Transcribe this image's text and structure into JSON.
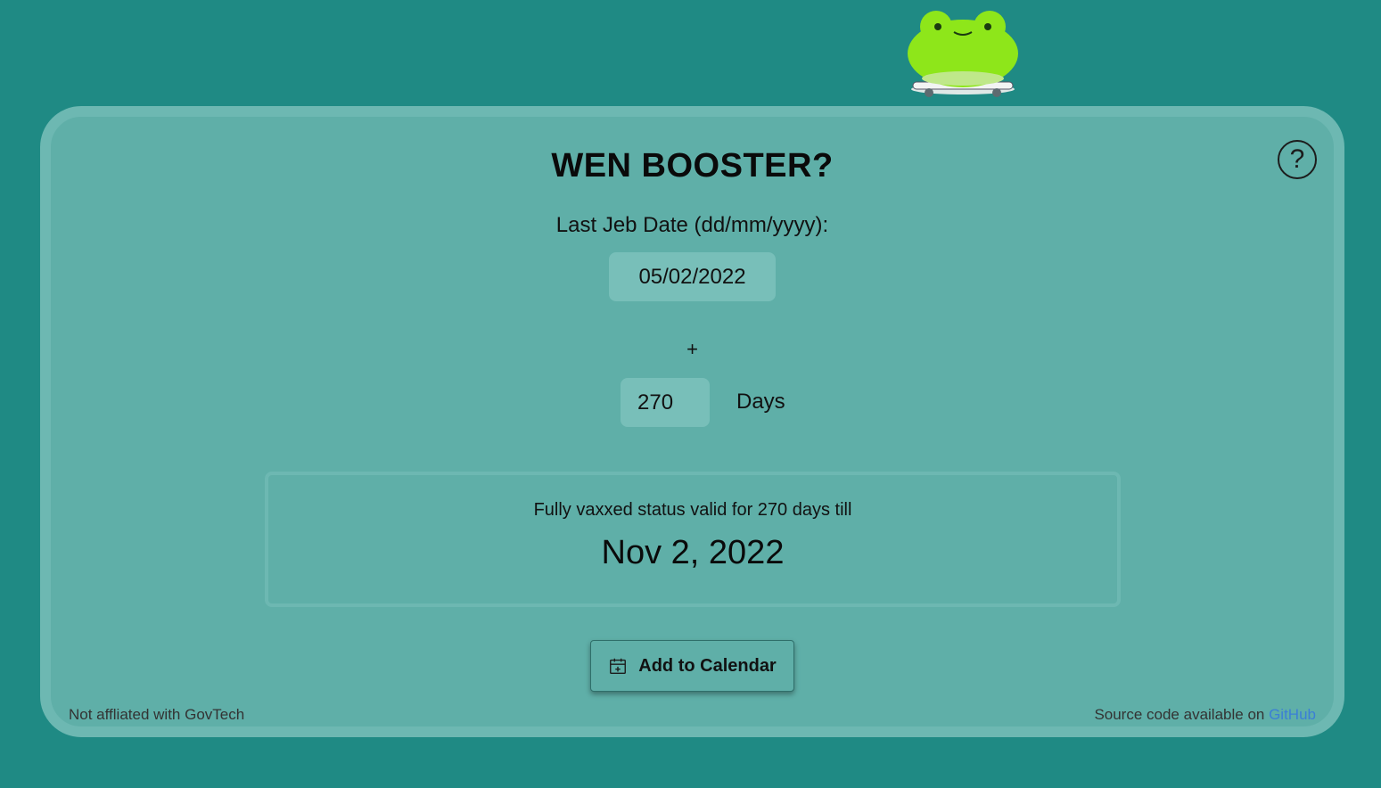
{
  "app": {
    "title": "WEN BOOSTER?",
    "help_label": "?"
  },
  "form": {
    "date_label": "Last Jeb Date (dd/mm/yyyy):",
    "date_value": "05/02/2022",
    "plus_sign": "+",
    "days_value": "270",
    "days_label": "Days"
  },
  "result": {
    "text": "Fully vaxxed status valid for 270 days till",
    "date": "Nov 2, 2022"
  },
  "actions": {
    "add_to_calendar_label": "Add to Calendar",
    "calendar_icon": "calendar-plus-icon"
  },
  "footer": {
    "disclaimer": "Not affliated with GovTech",
    "source_prefix": "Source code available on ",
    "source_link": "GitHub"
  },
  "colors": {
    "background": "#1f8a84",
    "card": "#5fafa8",
    "card_border": "#6db8b2",
    "input_bg": "#78bfb9",
    "link": "#3b7fd6",
    "frog": "#8ee61a"
  }
}
